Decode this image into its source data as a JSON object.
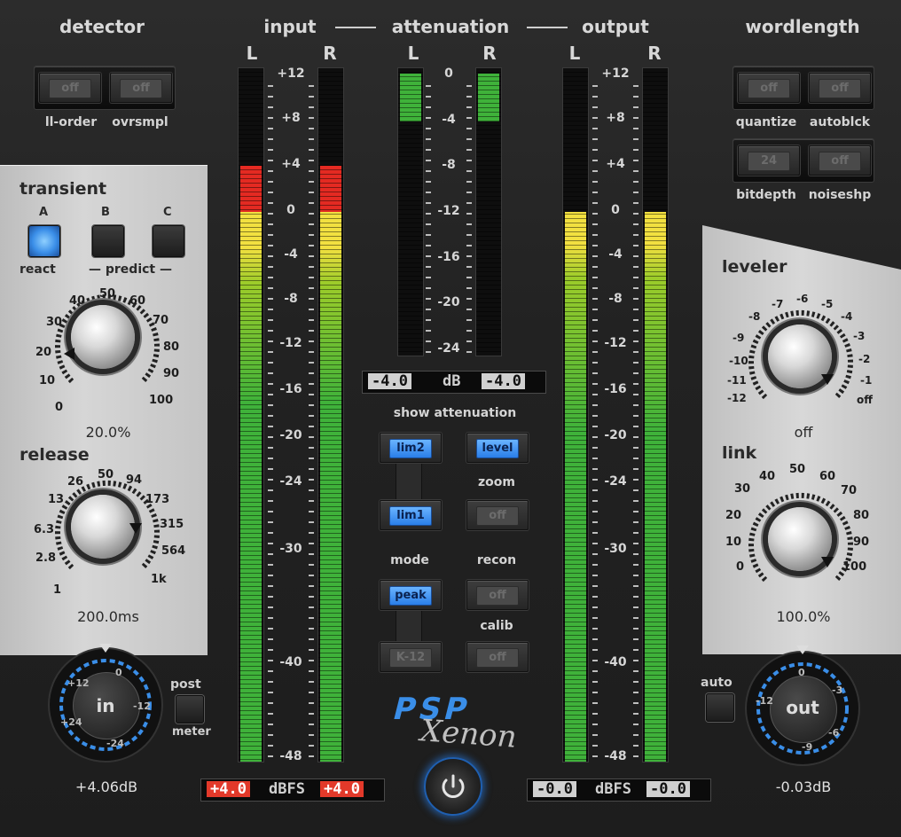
{
  "headers": {
    "detector": "detector",
    "input": "input",
    "attenuation": "attenuation",
    "output": "output",
    "wordlength": "wordlength"
  },
  "detector": {
    "ll_order": {
      "label": "ll-order",
      "state": "off"
    },
    "ovrsmpl": {
      "label": "ovrsmpl",
      "state": "off"
    }
  },
  "wordlength": {
    "quantize": {
      "label": "quantize",
      "state": "off"
    },
    "autoblck": {
      "label": "autoblck",
      "state": "off"
    },
    "bitdepth": {
      "label": "bitdepth",
      "state": "24"
    },
    "noiseshp": {
      "label": "noiseshp",
      "state": "off"
    }
  },
  "channels": {
    "L": "L",
    "R": "R"
  },
  "transient": {
    "title": "transient",
    "a": "A",
    "b": "B",
    "c": "C",
    "react": "react",
    "predict": "predict",
    "dial": [
      "0",
      "10",
      "20",
      "30",
      "40",
      "50",
      "60",
      "70",
      "80",
      "90",
      "100"
    ],
    "value": "20.0%"
  },
  "release": {
    "title": "release",
    "dial": [
      "1",
      "2.8",
      "6.3",
      "13",
      "26",
      "50",
      "94",
      "173",
      "315",
      "564",
      "1k"
    ],
    "value": "200.0ms"
  },
  "leveler": {
    "title": "leveler",
    "dial": [
      "-12",
      "-11",
      "-10",
      "-9",
      "-8",
      "-7",
      "-6",
      "-5",
      "-4",
      "-3",
      "-2",
      "-1",
      "off"
    ],
    "value": "off"
  },
  "link": {
    "title": "link",
    "dial": [
      "0",
      "10",
      "20",
      "30",
      "40",
      "50",
      "60",
      "70",
      "80",
      "90",
      "100"
    ],
    "value": "100.0%"
  },
  "meter_scale": [
    "+12",
    "+8",
    "+4",
    "0",
    "-4",
    "-8",
    "-12",
    "-16",
    "-20",
    "-24",
    "-30",
    "-40",
    "-48"
  ],
  "atten_scale": [
    "0",
    "-4",
    "-8",
    "-12",
    "-16",
    "-20",
    "-24"
  ],
  "levels": {
    "input_L_db": 4.0,
    "input_R_db": 4.0,
    "output_L_db": 0.0,
    "output_R_db": 0.0,
    "atten_L_db": -4.0,
    "atten_R_db": -4.0
  },
  "atten_display": {
    "left": "-4.0",
    "unit": "dB",
    "right": "-4.0"
  },
  "input_display": {
    "left": "+4.0",
    "unit": "dBFS",
    "right": "+4.0"
  },
  "output_display": {
    "left": "-0.0",
    "unit": "dBFS",
    "right": "-0.0"
  },
  "show_attenuation": {
    "label": "show attenuation",
    "lim2": "lim2",
    "level": "level",
    "lim1": "lim1",
    "zoom": "zoom",
    "zoom_state": "off"
  },
  "mode": {
    "label": "mode",
    "value": "peak",
    "recon": "recon",
    "recon_state": "off",
    "calib": "calib",
    "k12": "K-12",
    "calib_state": "off"
  },
  "in_knob": {
    "label": "in",
    "dial": [
      "+24",
      "+12",
      "0",
      "-12",
      "-24"
    ],
    "value": "+4.06dB"
  },
  "out_knob": {
    "label": "out",
    "dial": [
      "-12",
      "0",
      "-3",
      "-6",
      "-9"
    ],
    "value": "-0.03dB"
  },
  "post": {
    "post": "post",
    "meter": "meter"
  },
  "auto": "auto",
  "logo": {
    "brand": "PSP",
    "product": "Xenon"
  },
  "colors": {
    "accent": "#3a8ee8",
    "meter_green": "#3fb23a",
    "meter_yellow": "#f2e040",
    "meter_red": "#e42a22",
    "bg": "#222222"
  }
}
